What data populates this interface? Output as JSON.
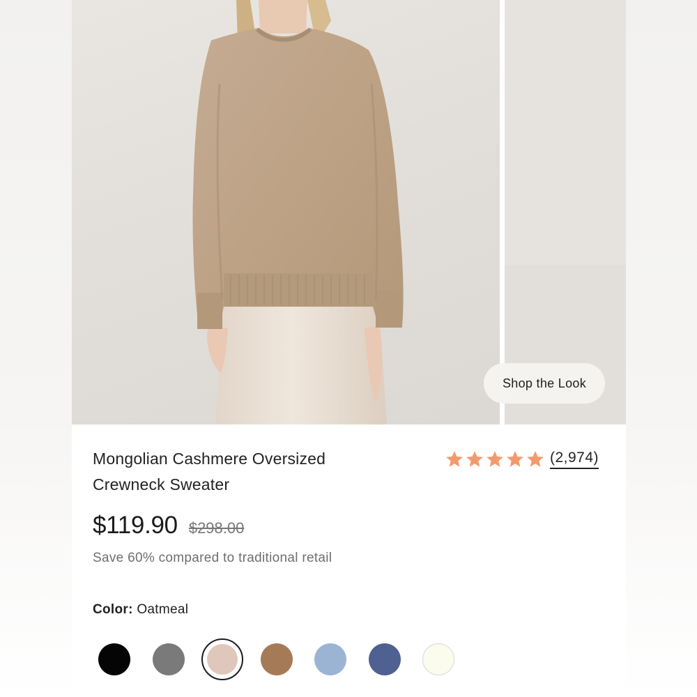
{
  "gallery": {
    "shop_the_look_label": "Shop the Look"
  },
  "product": {
    "title": "Mongolian Cashmere Oversized Crewneck Sweater",
    "rating_stars": 5,
    "rating_count": "(2,974)",
    "price_sale": "$119.90",
    "price_original": "$298.00",
    "savings_text": "Save 60% compared to traditional retail",
    "color_label": "Color:",
    "color_selected": "Oatmeal"
  },
  "swatches": [
    {
      "name": "black",
      "color": "#050505",
      "selected": false
    },
    {
      "name": "grey",
      "color": "#7a7a7a",
      "selected": false
    },
    {
      "name": "oatmeal",
      "color": "#dfc7bb",
      "selected": true
    },
    {
      "name": "camel",
      "color": "#a57b57",
      "selected": false
    },
    {
      "name": "light-blue",
      "color": "#9bb4d4",
      "selected": false
    },
    {
      "name": "navy",
      "color": "#4e6190",
      "selected": false
    },
    {
      "name": "ivory",
      "color": "#fbfbee",
      "selected": false
    }
  ],
  "colors": {
    "star": "#f39a6c",
    "text_primary": "#222222",
    "text_muted": "#6f6f6f"
  }
}
